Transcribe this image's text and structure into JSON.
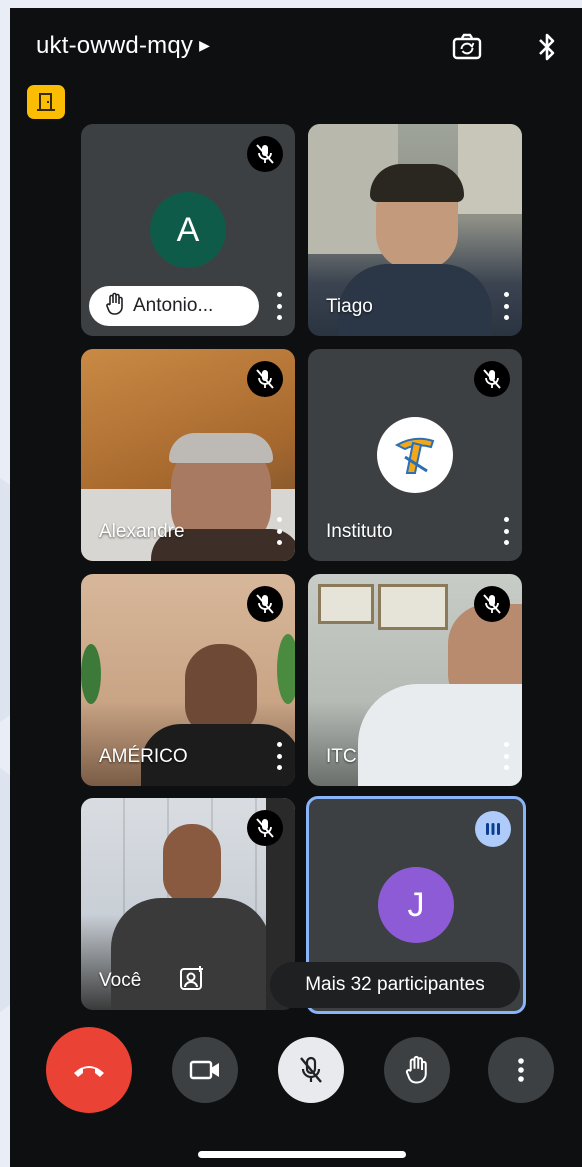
{
  "meeting": {
    "code": "ukt-owwd-mqy"
  },
  "icons": {
    "camera_switch": "camera-switch-icon",
    "bluetooth": "bluetooth-icon",
    "door": "door-exit-icon"
  },
  "tiles": [
    {
      "name": "Antonio...",
      "initial": "A",
      "avatar_color": "#0f5b4a",
      "muted": true,
      "hand_raised": true
    },
    {
      "name": "Tiago",
      "muted": false
    },
    {
      "name": "Alexandre",
      "muted": true
    },
    {
      "name": "Instituto",
      "muted": true
    },
    {
      "name": "AMÉRICO",
      "muted": true
    },
    {
      "name": "ITC",
      "muted": true
    },
    {
      "name": "Você",
      "muted": true
    },
    {
      "initial": "J",
      "avatar_color": "#8e5bd6",
      "speaking": true
    }
  ],
  "more_participants": "Mais 32 participantes",
  "colors": {
    "end_call": "#ea4335",
    "active_border": "#8ab4f8",
    "door_badge": "#fbbc04"
  }
}
